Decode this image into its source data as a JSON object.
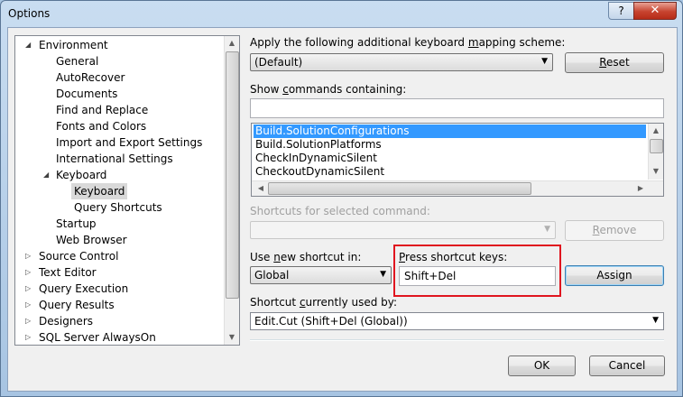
{
  "window": {
    "title": "Options",
    "help_glyph": "?",
    "close_glyph": "✕"
  },
  "tree": {
    "items": [
      {
        "label": "Environment",
        "arrow": "◢"
      },
      {
        "label": "General",
        "arrow": ""
      },
      {
        "label": "AutoRecover",
        "arrow": ""
      },
      {
        "label": "Documents",
        "arrow": ""
      },
      {
        "label": "Find and Replace",
        "arrow": ""
      },
      {
        "label": "Fonts and Colors",
        "arrow": ""
      },
      {
        "label": "Import and Export Settings",
        "arrow": ""
      },
      {
        "label": "International Settings",
        "arrow": ""
      },
      {
        "label": "Keyboard",
        "arrow": "◢"
      },
      {
        "label": "Keyboard",
        "arrow": ""
      },
      {
        "label": "Query Shortcuts",
        "arrow": ""
      },
      {
        "label": "Startup",
        "arrow": ""
      },
      {
        "label": "Web Browser",
        "arrow": ""
      },
      {
        "label": "Source Control",
        "arrow": "▷"
      },
      {
        "label": "Text Editor",
        "arrow": "▷"
      },
      {
        "label": "Query Execution",
        "arrow": "▷"
      },
      {
        "label": "Query Results",
        "arrow": "▷"
      },
      {
        "label": "Designers",
        "arrow": "▷"
      },
      {
        "label": "SQL Server AlwaysOn",
        "arrow": "▷"
      }
    ]
  },
  "mapping": {
    "label_a": "Apply the following additional keyboard ",
    "label_u": "m",
    "label_b": "apping scheme:",
    "value": "(Default)",
    "reset_a": "R",
    "reset_b": "eset"
  },
  "commands": {
    "label_a": "Show ",
    "label_u": "c",
    "label_b": "ommands containing:",
    "filter_value": "",
    "items": [
      "Build.SolutionConfigurations",
      "Build.SolutionPlatforms",
      "CheckInDynamicSilent",
      "CheckoutDynamicSilent"
    ]
  },
  "shortcuts_selected": {
    "label": "Shortcuts for selected command:",
    "value": "",
    "remove_a": "R",
    "remove_b": "emove"
  },
  "new_shortcut": {
    "label_a": "Use ",
    "label_u": "n",
    "label_b": "ew shortcut in:",
    "value": "Global"
  },
  "press_keys": {
    "label_u": "P",
    "label_b": "ress shortcut keys:",
    "value": "Shift+Del",
    "assign_label": "Assign"
  },
  "currently_used": {
    "label_a": "Shortcut ",
    "label_u": "c",
    "label_b": "urrently used by:",
    "value": "Edit.Cut (Shift+Del (Global))"
  },
  "footer": {
    "ok": "OK",
    "cancel": "Cancel"
  },
  "colors": {
    "accent": "#3399ff",
    "highlight": "#e0151f"
  }
}
